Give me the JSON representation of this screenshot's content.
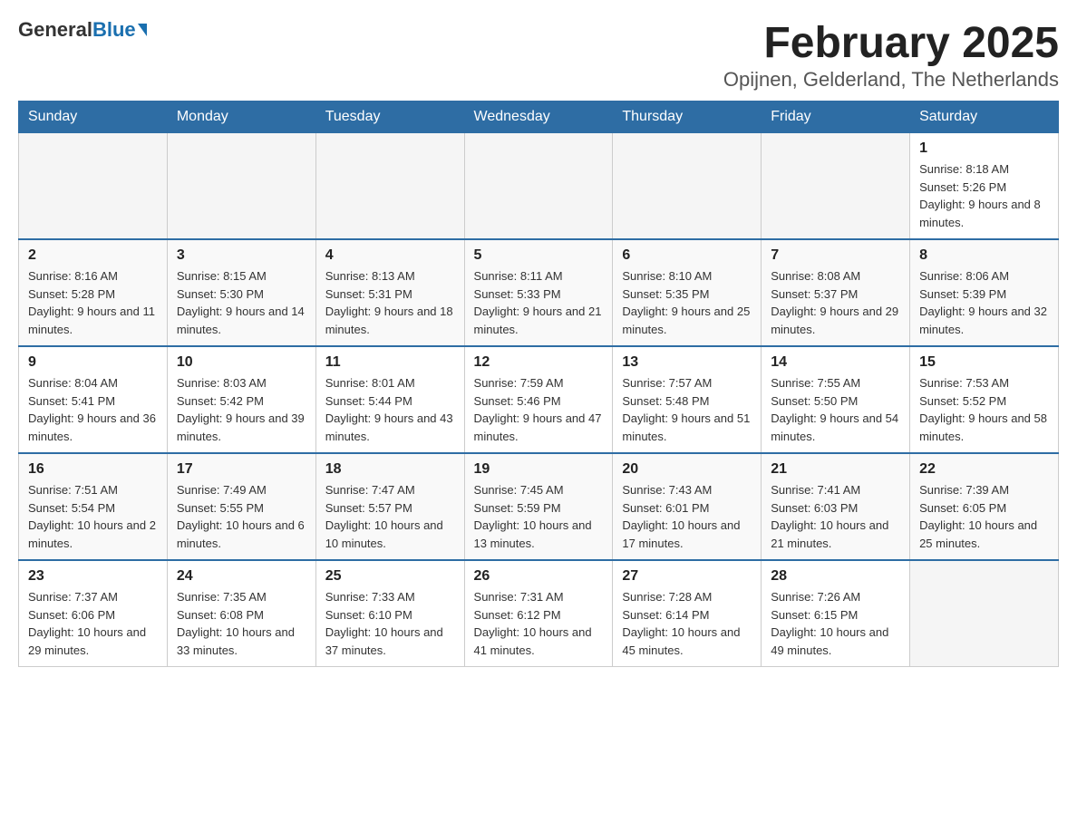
{
  "header": {
    "logo_main": "General",
    "logo_accent": "Blue",
    "title": "February 2025",
    "subtitle": "Opijnen, Gelderland, The Netherlands"
  },
  "calendar": {
    "days_of_week": [
      "Sunday",
      "Monday",
      "Tuesday",
      "Wednesday",
      "Thursday",
      "Friday",
      "Saturday"
    ],
    "weeks": [
      [
        {
          "day": "",
          "info": []
        },
        {
          "day": "",
          "info": []
        },
        {
          "day": "",
          "info": []
        },
        {
          "day": "",
          "info": []
        },
        {
          "day": "",
          "info": []
        },
        {
          "day": "",
          "info": []
        },
        {
          "day": "1",
          "info": [
            "Sunrise: 8:18 AM",
            "Sunset: 5:26 PM",
            "Daylight: 9 hours and 8 minutes."
          ]
        }
      ],
      [
        {
          "day": "2",
          "info": [
            "Sunrise: 8:16 AM",
            "Sunset: 5:28 PM",
            "Daylight: 9 hours and 11 minutes."
          ]
        },
        {
          "day": "3",
          "info": [
            "Sunrise: 8:15 AM",
            "Sunset: 5:30 PM",
            "Daylight: 9 hours and 14 minutes."
          ]
        },
        {
          "day": "4",
          "info": [
            "Sunrise: 8:13 AM",
            "Sunset: 5:31 PM",
            "Daylight: 9 hours and 18 minutes."
          ]
        },
        {
          "day": "5",
          "info": [
            "Sunrise: 8:11 AM",
            "Sunset: 5:33 PM",
            "Daylight: 9 hours and 21 minutes."
          ]
        },
        {
          "day": "6",
          "info": [
            "Sunrise: 8:10 AM",
            "Sunset: 5:35 PM",
            "Daylight: 9 hours and 25 minutes."
          ]
        },
        {
          "day": "7",
          "info": [
            "Sunrise: 8:08 AM",
            "Sunset: 5:37 PM",
            "Daylight: 9 hours and 29 minutes."
          ]
        },
        {
          "day": "8",
          "info": [
            "Sunrise: 8:06 AM",
            "Sunset: 5:39 PM",
            "Daylight: 9 hours and 32 minutes."
          ]
        }
      ],
      [
        {
          "day": "9",
          "info": [
            "Sunrise: 8:04 AM",
            "Sunset: 5:41 PM",
            "Daylight: 9 hours and 36 minutes."
          ]
        },
        {
          "day": "10",
          "info": [
            "Sunrise: 8:03 AM",
            "Sunset: 5:42 PM",
            "Daylight: 9 hours and 39 minutes."
          ]
        },
        {
          "day": "11",
          "info": [
            "Sunrise: 8:01 AM",
            "Sunset: 5:44 PM",
            "Daylight: 9 hours and 43 minutes."
          ]
        },
        {
          "day": "12",
          "info": [
            "Sunrise: 7:59 AM",
            "Sunset: 5:46 PM",
            "Daylight: 9 hours and 47 minutes."
          ]
        },
        {
          "day": "13",
          "info": [
            "Sunrise: 7:57 AM",
            "Sunset: 5:48 PM",
            "Daylight: 9 hours and 51 minutes."
          ]
        },
        {
          "day": "14",
          "info": [
            "Sunrise: 7:55 AM",
            "Sunset: 5:50 PM",
            "Daylight: 9 hours and 54 minutes."
          ]
        },
        {
          "day": "15",
          "info": [
            "Sunrise: 7:53 AM",
            "Sunset: 5:52 PM",
            "Daylight: 9 hours and 58 minutes."
          ]
        }
      ],
      [
        {
          "day": "16",
          "info": [
            "Sunrise: 7:51 AM",
            "Sunset: 5:54 PM",
            "Daylight: 10 hours and 2 minutes."
          ]
        },
        {
          "day": "17",
          "info": [
            "Sunrise: 7:49 AM",
            "Sunset: 5:55 PM",
            "Daylight: 10 hours and 6 minutes."
          ]
        },
        {
          "day": "18",
          "info": [
            "Sunrise: 7:47 AM",
            "Sunset: 5:57 PM",
            "Daylight: 10 hours and 10 minutes."
          ]
        },
        {
          "day": "19",
          "info": [
            "Sunrise: 7:45 AM",
            "Sunset: 5:59 PM",
            "Daylight: 10 hours and 13 minutes."
          ]
        },
        {
          "day": "20",
          "info": [
            "Sunrise: 7:43 AM",
            "Sunset: 6:01 PM",
            "Daylight: 10 hours and 17 minutes."
          ]
        },
        {
          "day": "21",
          "info": [
            "Sunrise: 7:41 AM",
            "Sunset: 6:03 PM",
            "Daylight: 10 hours and 21 minutes."
          ]
        },
        {
          "day": "22",
          "info": [
            "Sunrise: 7:39 AM",
            "Sunset: 6:05 PM",
            "Daylight: 10 hours and 25 minutes."
          ]
        }
      ],
      [
        {
          "day": "23",
          "info": [
            "Sunrise: 7:37 AM",
            "Sunset: 6:06 PM",
            "Daylight: 10 hours and 29 minutes."
          ]
        },
        {
          "day": "24",
          "info": [
            "Sunrise: 7:35 AM",
            "Sunset: 6:08 PM",
            "Daylight: 10 hours and 33 minutes."
          ]
        },
        {
          "day": "25",
          "info": [
            "Sunrise: 7:33 AM",
            "Sunset: 6:10 PM",
            "Daylight: 10 hours and 37 minutes."
          ]
        },
        {
          "day": "26",
          "info": [
            "Sunrise: 7:31 AM",
            "Sunset: 6:12 PM",
            "Daylight: 10 hours and 41 minutes."
          ]
        },
        {
          "day": "27",
          "info": [
            "Sunrise: 7:28 AM",
            "Sunset: 6:14 PM",
            "Daylight: 10 hours and 45 minutes."
          ]
        },
        {
          "day": "28",
          "info": [
            "Sunrise: 7:26 AM",
            "Sunset: 6:15 PM",
            "Daylight: 10 hours and 49 minutes."
          ]
        },
        {
          "day": "",
          "info": []
        }
      ]
    ]
  }
}
